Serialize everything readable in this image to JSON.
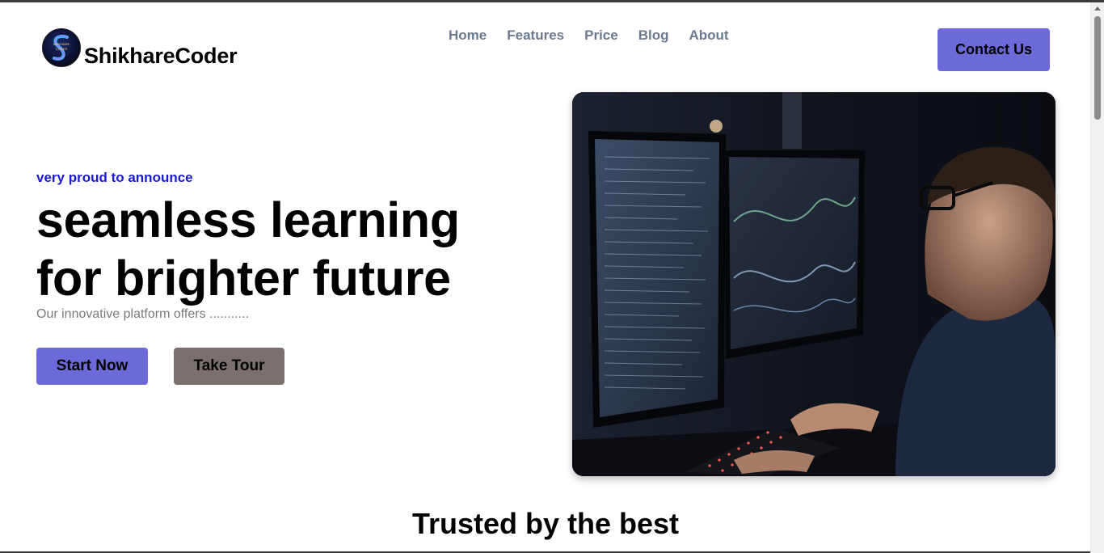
{
  "brand": {
    "name": "ShikhareCoder",
    "logo_icon": "shikharecoder-logo-icon"
  },
  "nav": {
    "items": [
      "Home",
      "Features",
      "Price",
      "Blog",
      "About"
    ]
  },
  "header": {
    "contact_label": "Contact Us"
  },
  "hero": {
    "announce": "very proud to announce",
    "headline_line1": "seamless learning",
    "headline_line2": "for brighter future",
    "subtitle": "Our innovative platform offers ...........",
    "start_label": "Start Now",
    "tour_label": "Take Tour",
    "image_icon": "programmer-at-monitors-photo"
  },
  "section": {
    "trusted_title": "Trusted by the best"
  },
  "colors": {
    "accent": "#6b6ad8",
    "announce": "#1a1ad6",
    "tour": "#7a716e",
    "nav": "#6b7a8f"
  }
}
